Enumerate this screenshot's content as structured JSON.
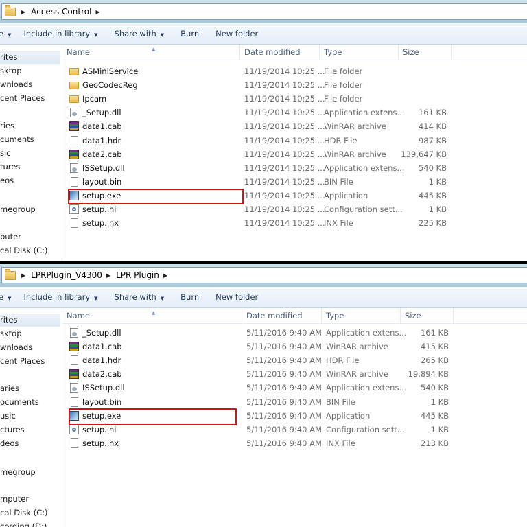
{
  "toolbar": {
    "include": "Include in library",
    "share": "Share with",
    "burn": "Burn",
    "newfolder": "New folder"
  },
  "columns": {
    "name": "Name",
    "date": "Date modified",
    "type": "Type",
    "size": "Size"
  },
  "top": {
    "breadcrumbs": [
      "Access Control"
    ],
    "toolbar_first_partial": "e",
    "nav": [
      {
        "label": "rites",
        "selected": true
      },
      {
        "label": "sktop"
      },
      {
        "label": "wnloads"
      },
      {
        "label": "cent Places"
      },
      {
        "label": ""
      },
      {
        "label": "ries"
      },
      {
        "label": "cuments"
      },
      {
        "label": "sic"
      },
      {
        "label": "tures"
      },
      {
        "label": "eos"
      },
      {
        "label": ""
      },
      {
        "label": "megroup"
      },
      {
        "label": ""
      },
      {
        "label": "puter"
      },
      {
        "label": "cal Disk (C:)"
      }
    ],
    "files": [
      {
        "name": "ASMiniService",
        "date": "11/19/2014 10:25 ...",
        "type": "File folder",
        "size": "",
        "icon": "folder-icon"
      },
      {
        "name": "GeoCodecReg",
        "date": "11/19/2014 10:25 ...",
        "type": "File folder",
        "size": "",
        "icon": "folder-icon"
      },
      {
        "name": "Ipcam",
        "date": "11/19/2014 10:25 ...",
        "type": "File folder",
        "size": "",
        "icon": "folder-icon"
      },
      {
        "name": "_Setup.dll",
        "date": "11/19/2014 10:25 ...",
        "type": "Application extens...",
        "size": "161 KB",
        "icon": "dll-icon"
      },
      {
        "name": "data1.cab",
        "date": "11/19/2014 10:25 ...",
        "type": "WinRAR archive",
        "size": "414 KB",
        "icon": "winrar-icon"
      },
      {
        "name": "data1.hdr",
        "date": "11/19/2014 10:25 ...",
        "type": "HDR File",
        "size": "987 KB",
        "icon": "file-icon"
      },
      {
        "name": "data2.cab",
        "date": "11/19/2014 10:25 ...",
        "type": "WinRAR archive",
        "size": "139,647 KB",
        "icon": "winrar-icon"
      },
      {
        "name": "ISSetup.dll",
        "date": "11/19/2014 10:25 ...",
        "type": "Application extens...",
        "size": "540 KB",
        "icon": "dll-icon"
      },
      {
        "name": "layout.bin",
        "date": "11/19/2014 10:25 ...",
        "type": "BIN File",
        "size": "1 KB",
        "icon": "file-icon"
      },
      {
        "name": "setup.exe",
        "date": "11/19/2014 10:25 ...",
        "type": "Application",
        "size": "445 KB",
        "icon": "exe-icon",
        "highlighted": true
      },
      {
        "name": "setup.ini",
        "date": "11/19/2014 10:25 ...",
        "type": "Configuration sett...",
        "size": "1 KB",
        "icon": "ini-icon"
      },
      {
        "name": "setup.inx",
        "date": "11/19/2014 10:25 ...",
        "type": "INX File",
        "size": "225 KB",
        "icon": "file-icon"
      }
    ]
  },
  "bottom": {
    "breadcrumbs": [
      "LPRPlugin_V4300",
      "LPR Plugin"
    ],
    "toolbar_first_partial": "e",
    "nav": [
      {
        "label": "rites",
        "selected": true
      },
      {
        "label": "sktop"
      },
      {
        "label": "wnloads"
      },
      {
        "label": "cent Places"
      },
      {
        "label": ""
      },
      {
        "label": "aries"
      },
      {
        "label": "ocuments"
      },
      {
        "label": "usic"
      },
      {
        "label": "ctures"
      },
      {
        "label": "deos"
      },
      {
        "label": ""
      },
      {
        "label": "megroup"
      },
      {
        "label": ""
      },
      {
        "label": "mputer"
      },
      {
        "label": "cal Disk (C:)"
      },
      {
        "label": "cording (D:)"
      }
    ],
    "files": [
      {
        "name": "_Setup.dll",
        "date": "5/11/2016 9:40 AM",
        "type": "Application extens...",
        "size": "161 KB",
        "icon": "dll-icon"
      },
      {
        "name": "data1.cab",
        "date": "5/11/2016 9:40 AM",
        "type": "WinRAR archive",
        "size": "415 KB",
        "icon": "winrar-icon"
      },
      {
        "name": "data1.hdr",
        "date": "5/11/2016 9:40 AM",
        "type": "HDR File",
        "size": "265 KB",
        "icon": "file-icon"
      },
      {
        "name": "data2.cab",
        "date": "5/11/2016 9:40 AM",
        "type": "WinRAR archive",
        "size": "19,894 KB",
        "icon": "winrar-icon"
      },
      {
        "name": "ISSetup.dll",
        "date": "5/11/2016 9:40 AM",
        "type": "Application extens...",
        "size": "540 KB",
        "icon": "dll-icon"
      },
      {
        "name": "layout.bin",
        "date": "5/11/2016 9:40 AM",
        "type": "BIN File",
        "size": "1 KB",
        "icon": "file-icon"
      },
      {
        "name": "setup.exe",
        "date": "5/11/2016 9:40 AM",
        "type": "Application",
        "size": "445 KB",
        "icon": "exe-icon",
        "highlighted": true
      },
      {
        "name": "setup.ini",
        "date": "5/11/2016 9:40 AM",
        "type": "Configuration sett...",
        "size": "1 KB",
        "icon": "ini-icon"
      },
      {
        "name": "setup.inx",
        "date": "5/11/2016 9:40 AM",
        "type": "INX File",
        "size": "213 KB",
        "icon": "file-icon"
      }
    ]
  }
}
